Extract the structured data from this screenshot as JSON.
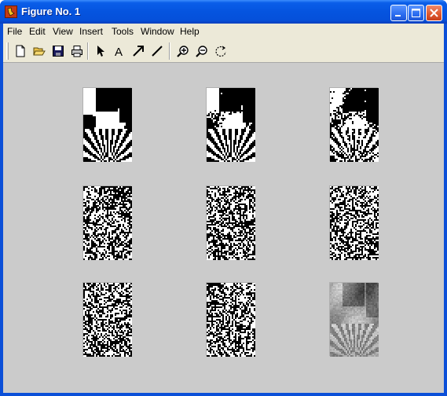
{
  "window": {
    "title": "Figure No. 1"
  },
  "title_buttons": {
    "minimize": "minimize-icon",
    "maximize": "maximize-icon",
    "close": "close-icon"
  },
  "menu": [
    "File",
    "Edit",
    "View",
    "Insert",
    "Tools",
    "Window",
    "Help"
  ],
  "toolbar": {
    "tools": [
      "new-figure-icon",
      "open-icon",
      "save-icon",
      "print-icon",
      "select-arrow-icon",
      "insert-text-icon",
      "insert-arrow-icon",
      "insert-line-icon",
      "zoom-in-icon",
      "zoom-out-icon",
      "rotate-icon"
    ],
    "text_tool_label": "A"
  },
  "figure": {
    "subplots": [
      {
        "row": 1,
        "col": 1,
        "content": "bit-plane-binary"
      },
      {
        "row": 1,
        "col": 2,
        "content": "bit-plane-binary"
      },
      {
        "row": 1,
        "col": 3,
        "content": "bit-plane-binary"
      },
      {
        "row": 2,
        "col": 1,
        "content": "bit-plane-noise"
      },
      {
        "row": 2,
        "col": 2,
        "content": "bit-plane-noise"
      },
      {
        "row": 2,
        "col": 3,
        "content": "bit-plane-noise"
      },
      {
        "row": 3,
        "col": 1,
        "content": "bit-plane-noise"
      },
      {
        "row": 3,
        "col": 2,
        "content": "bit-plane-noise"
      },
      {
        "row": 3,
        "col": 3,
        "content": "grayscale-photo"
      }
    ]
  },
  "colors": {
    "titlebar": "#0554df",
    "canvas": "#cbcbcb",
    "menubar": "#ece9d8"
  }
}
